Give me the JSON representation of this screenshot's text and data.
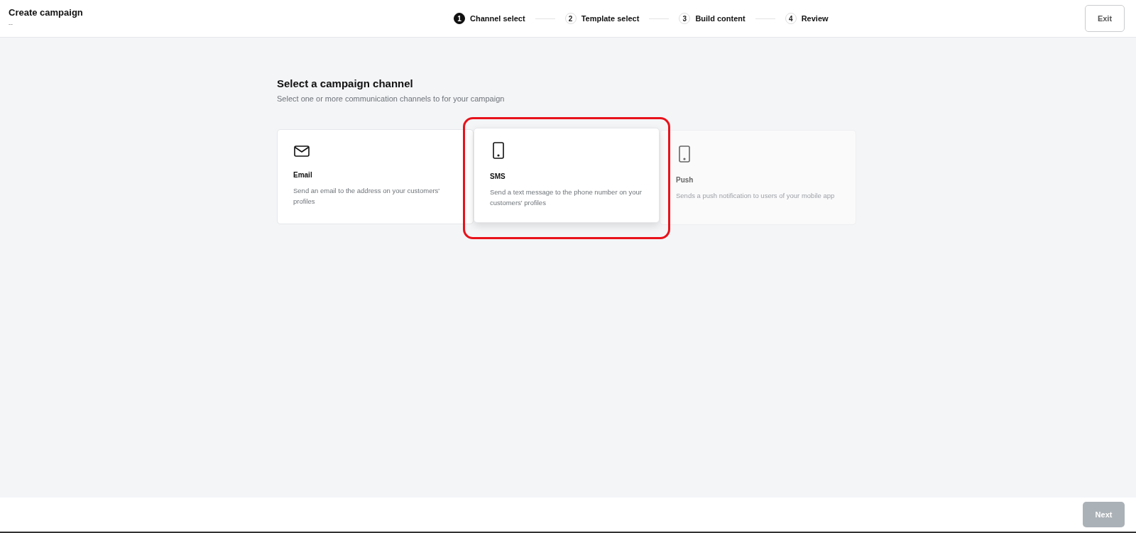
{
  "header": {
    "title": "Create campaign",
    "subtitle": "--"
  },
  "steps": [
    {
      "number": "1",
      "label": "Channel select",
      "selected": true
    },
    {
      "number": "2",
      "label": "Template select",
      "selected": false
    },
    {
      "number": "3",
      "label": "Build content",
      "selected": false
    },
    {
      "number": "4",
      "label": "Review",
      "selected": false
    }
  ],
  "exit_button": "Exit",
  "heading": "Select a campaign channel",
  "subheading": "Select one or more communication channels to for your campaign",
  "channels": [
    {
      "kind": "email",
      "name": "Email",
      "description": "Send an email to the address on your customers' profiles",
      "selected": false,
      "disabled": false,
      "highlighted": false
    },
    {
      "kind": "phone",
      "name": "SMS",
      "description": "Send a text message to the phone number on your customers' profiles",
      "selected": true,
      "disabled": false,
      "highlighted": true
    },
    {
      "kind": "phone",
      "name": "Push",
      "description": "Sends a push notification to users of your mobile app",
      "selected": false,
      "disabled": true,
      "highlighted": false
    }
  ],
  "next_button": {
    "label": "Next",
    "disabled": true
  }
}
